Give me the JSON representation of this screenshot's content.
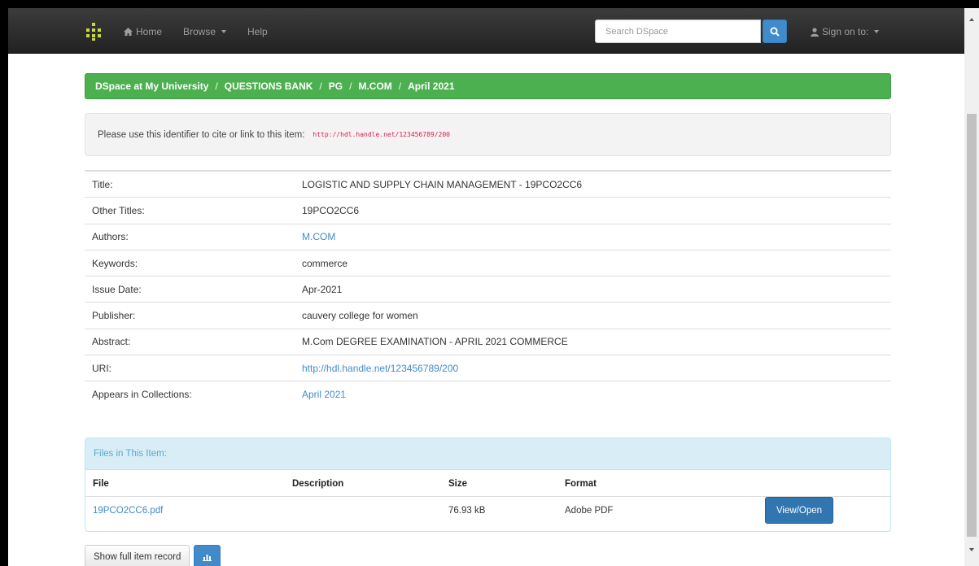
{
  "nav": {
    "home_label": "Home",
    "browse_label": "Browse",
    "help_label": "Help",
    "search_placeholder": "Search DSpace",
    "signon_label": "Sign on to:"
  },
  "breadcrumb": [
    "DSpace at My University",
    "QUESTIONS BANK",
    "PG",
    "M.COM",
    "April 2021"
  ],
  "identifier": {
    "text": "Please use this identifier to cite or link to this item:",
    "url": "http://hdl.handle.net/123456789/200"
  },
  "metadata": [
    {
      "label": "Title:",
      "value": "LOGISTIC AND SUPPLY CHAIN MANAGEMENT - 19PCO2CC6",
      "link": false
    },
    {
      "label": "Other Titles:",
      "value": "19PCO2CC6",
      "link": false
    },
    {
      "label": "Authors:",
      "value": "M.COM",
      "link": true
    },
    {
      "label": "Keywords:",
      "value": "commerce",
      "link": false
    },
    {
      "label": "Issue Date:",
      "value": "Apr-2021",
      "link": false
    },
    {
      "label": "Publisher:",
      "value": "cauvery college for women",
      "link": false
    },
    {
      "label": "Abstract:",
      "value": "M.Com DEGREE EXAMINATION - APRIL 2021 COMMERCE",
      "link": false
    },
    {
      "label": "URI:",
      "value": "http://hdl.handle.net/123456789/200",
      "link": true
    },
    {
      "label": "Appears in Collections:",
      "value": "April 2021",
      "link": true
    }
  ],
  "files": {
    "heading": "Files in This Item:",
    "columns": [
      "File",
      "Description",
      "Size",
      "Format"
    ],
    "rows": [
      {
        "file": "19PCO2CC6.pdf",
        "description": "",
        "size": "76.93 kB",
        "format": "Adobe PDF",
        "action": "View/Open"
      }
    ]
  },
  "buttons": {
    "full_record": "Show full item record"
  },
  "colors": {
    "navbar": "#222222",
    "breadcrumb": "#4cb050",
    "primary": "#428bca",
    "panel_heading": "#d9edf7"
  }
}
